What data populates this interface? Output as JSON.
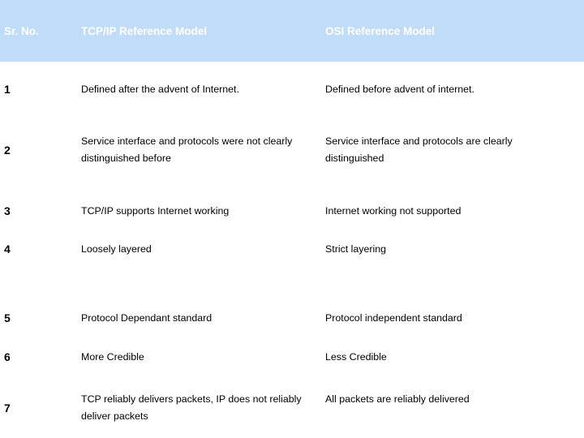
{
  "header": {
    "columns": [
      {
        "label": "Sr. No."
      },
      {
        "label": "TCP/IP Reference Model"
      },
      {
        "label": "OSI Reference Model"
      }
    ],
    "background_color": "#c1dcf8",
    "text_color": "#ffffff"
  },
  "rows": [
    {
      "num": "1",
      "tcp": "Defined after the advent of Internet.",
      "osi": "Defined before advent of internet."
    },
    {
      "num": "2",
      "tcp": "Service interface and protocols were not clearly distinguished before",
      "osi": "Service interface and protocols are clearly distinguished"
    },
    {
      "num": "3",
      "tcp": "TCP/IP supports Internet working",
      "osi": "Internet working not supported"
    },
    {
      "num": "4",
      "tcp": "Loosely layered",
      "osi": "Strict layering"
    },
    {
      "num": "5",
      "tcp": "Protocol Dependant standard",
      "osi": "Protocol independent standard"
    },
    {
      "num": "6",
      "tcp": "More Credible",
      "osi": "Less Credible"
    },
    {
      "num": "7",
      "tcp": "TCP reliably delivers packets, IP does not reliably deliver packets",
      "osi": "All packets are reliably delivered"
    }
  ],
  "page": {
    "background_color": "#ffffff",
    "body_text_color": "#000000"
  }
}
